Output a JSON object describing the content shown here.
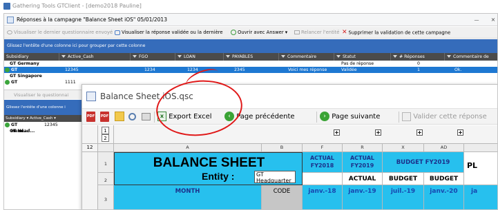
{
  "app": {
    "title": "Gathering Tools GTClient - [demo2018 Pauline]"
  },
  "campaign_window": {
    "title": "Réponses à la campagne \"Balance Sheet iOS\" 05/01/2013",
    "minimize_label": "—",
    "close_label": "×",
    "toolbar": {
      "view_last": "Visualiser le dernier questionnaire envoyé",
      "view_validated": "Visualiser la réponse validée ou la dernière",
      "open_with": "Ouvrir avec Answer",
      "relaunch": "Relancer l'entité",
      "remove_validation": "Supprimer la validation de cette campagne"
    },
    "group_hint": "Glissez l'entête d'une colonne ici pour grouper par cette colonne",
    "columns": [
      "Subsidiary",
      "Active_Cash",
      "FGO",
      "LOAN",
      "PAYABLES",
      "Commentaire",
      "Statut",
      "# Réponses",
      "Commentaire de valid"
    ],
    "rows": [
      {
        "subsidiary": "GT Germany",
        "active_cash": "",
        "fgo": "",
        "loan": "",
        "payables": "",
        "comment": "",
        "status": "Pas de réponse",
        "count": "0",
        "valid_comment": ""
      },
      {
        "subsidiary": "GT Headquarters",
        "active_cash": "12345",
        "fgo": "1234",
        "loan": "1234",
        "payables": "2345",
        "comment": "Voici mes réponse",
        "status": "Validée",
        "count": "1",
        "valid_comment": "Ok."
      },
      {
        "subsidiary": "GT Singapore",
        "active_cash": "",
        "fgo": "",
        "loan": "",
        "payables": "",
        "comment": "",
        "status": "",
        "count": "",
        "valid_comment": ""
      },
      {
        "subsidiary": "GT UK",
        "active_cash": "1111",
        "fgo": "",
        "loan": "",
        "payables": "",
        "comment": "",
        "status": "",
        "count": "",
        "valid_comment": ""
      }
    ]
  },
  "left_panel": {
    "toolbar_label": "Visualiser le questionnai",
    "group_hint": "Glissez l'entête d'une colonne i",
    "columns": "Subsidiary ▾ Active_Cash ▾",
    "rows": [
      {
        "subsidiary": "GT Head...",
        "value": "12345"
      },
      {
        "subsidiary": "GT Head...",
        "value": ""
      }
    ]
  },
  "balance_window": {
    "title": "Balance Sheet iOS.qsc",
    "toolbar": {
      "export_excel": "Export Excel",
      "prev_page": "Page précédente",
      "next_page": "Page suivante",
      "validate": "Valider cette réponse"
    },
    "sheet": {
      "outline_levels_rows": [
        "1",
        "2"
      ],
      "outline_levels_cols": [
        "1",
        "2"
      ],
      "col_letters": [
        "A",
        "B",
        "F",
        "R",
        "X",
        "AD"
      ],
      "row_numbers": [
        "1",
        "2",
        "3"
      ],
      "title": "BALANCE SHEET",
      "entity_label": "Entity :",
      "entity_value": "GT Headquarter",
      "f_header_1": "ACTUAL",
      "f_header_2": "FY2018",
      "r_header_1": "ACTUAL",
      "r_header_2": "FY2019",
      "r_sub": "ACTUAL",
      "budget_header": "BUDGET FY2019",
      "x_sub": "BUDGET",
      "ad_sub": "BUDGET",
      "pl_partial": "PL",
      "month_label": "MONTH",
      "code_label": "CODE",
      "f_month": "janv.-18",
      "r_month": "janv.-19",
      "x_month": "juil.-19",
      "ad_month": "janv.-20",
      "last_month_partial": "ja"
    }
  },
  "colors": {
    "accent_blue": "#356cbb",
    "selection": "#1e78d2",
    "header_cyan": "#27c0ee",
    "annotation_red": "#e01818"
  }
}
